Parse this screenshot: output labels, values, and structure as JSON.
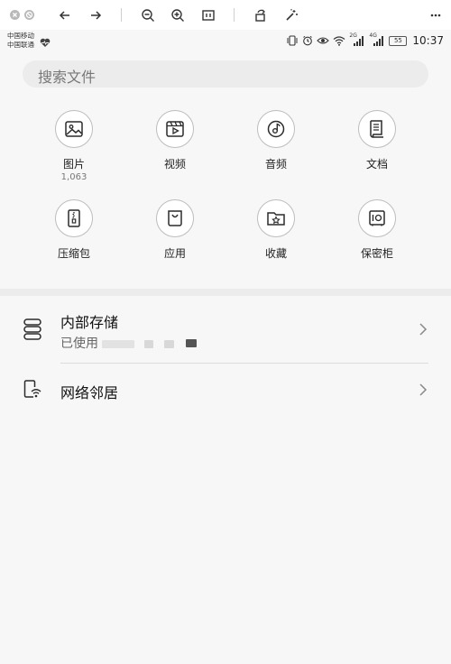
{
  "status": {
    "carrier_line1": "中国移动",
    "carrier_line2": "中国联通",
    "network_1": "2G",
    "network_2": "4G",
    "battery": "55",
    "time": "10:37"
  },
  "search": {
    "placeholder": "搜索文件"
  },
  "categories": [
    {
      "label": "图片",
      "count": "1,063",
      "icon": "image-icon"
    },
    {
      "label": "视频",
      "icon": "video-icon"
    },
    {
      "label": "音频",
      "icon": "music-icon"
    },
    {
      "label": "文档",
      "icon": "document-icon"
    },
    {
      "label": "压缩包",
      "icon": "zip-icon"
    },
    {
      "label": "应用",
      "icon": "app-bag-icon"
    },
    {
      "label": "收藏",
      "icon": "favorite-folder-icon"
    },
    {
      "label": "保密柜",
      "icon": "safe-icon"
    }
  ],
  "storage": {
    "title": "内部存储",
    "subtitle": "已使用"
  },
  "network": {
    "title": "网络邻居"
  },
  "colors": {
    "background": "#f7f7f7",
    "search_bg": "#ececec",
    "icon_stroke": "#2b2b2b",
    "circle_border": "#bdbdbd"
  }
}
